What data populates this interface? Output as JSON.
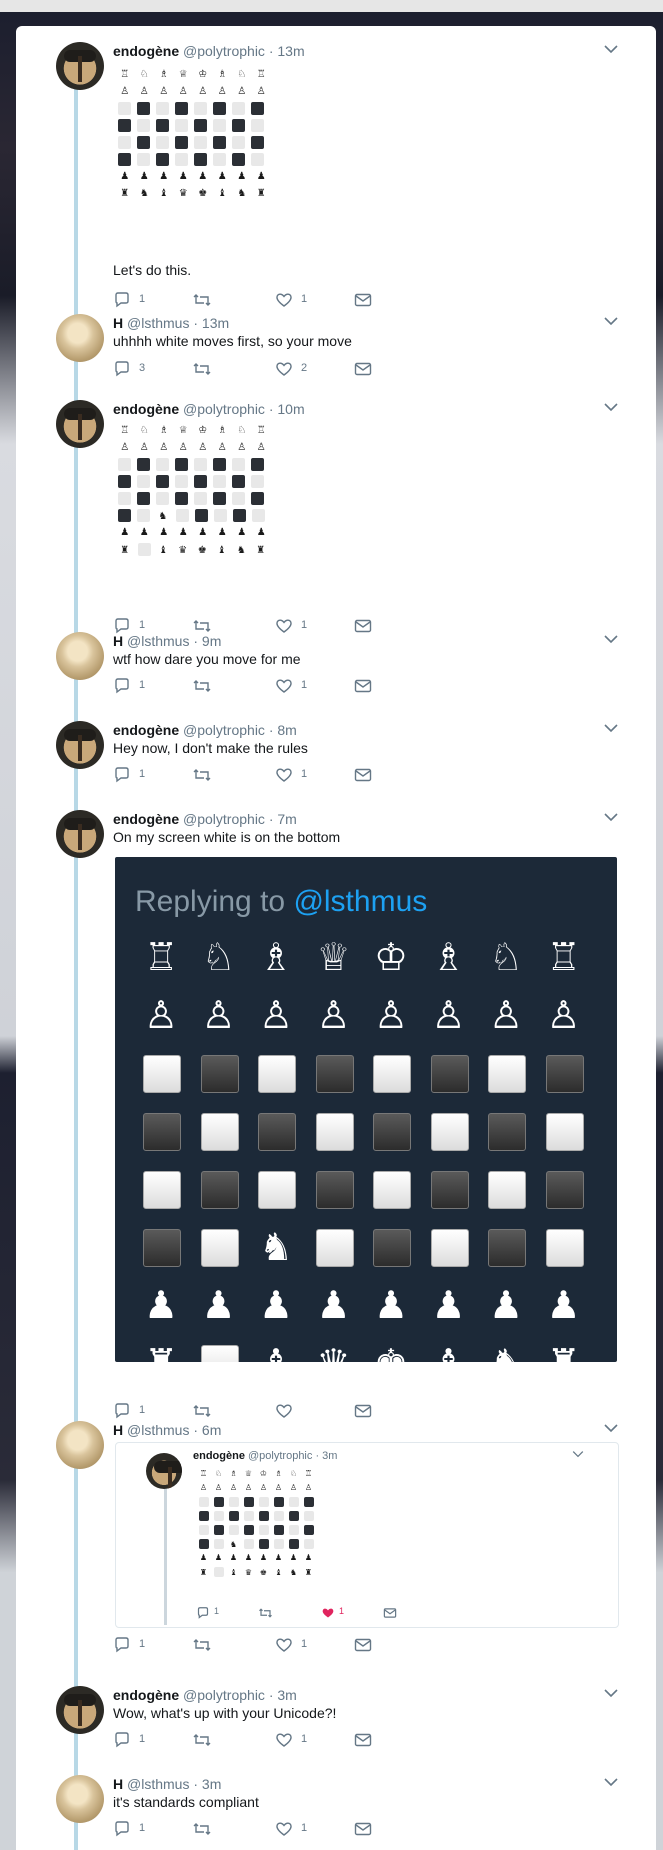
{
  "colors": {
    "accent": "#1da1f2",
    "text": "#14171a",
    "muted": "#657786",
    "thread": "#b8d8e6",
    "liked": "#e0245e"
  },
  "tweets": [
    {
      "name": "endogène",
      "handle": "@polytrophic",
      "time": "· 13m",
      "text": "Let's do this.",
      "replies": "1",
      "likes": "1",
      "avatar": "endo-avatar"
    },
    {
      "name": "H",
      "handle": "@lsthmus",
      "time": "· 13m",
      "text": "uhhhh white moves first, so your move",
      "replies": "3",
      "likes": "2",
      "avatar": "h-avatar"
    },
    {
      "name": "endogène",
      "handle": "@polytrophic",
      "time": "· 10m",
      "text": "",
      "replies": "1",
      "likes": "1",
      "avatar": "endo-avatar"
    },
    {
      "name": "H",
      "handle": "@lsthmus",
      "time": "· 9m",
      "text": "wtf how dare you move for me",
      "replies": "1",
      "likes": "1",
      "avatar": "h-avatar"
    },
    {
      "name": "endogène",
      "handle": "@polytrophic",
      "time": "· 8m",
      "text": "Hey now, I don't make the rules",
      "replies": "1",
      "likes": "1",
      "avatar": "endo-avatar"
    },
    {
      "name": "endogène",
      "handle": "@polytrophic",
      "time": "· 7m",
      "text": "On my screen white is on the bottom",
      "replies": "1",
      "likes": "",
      "avatar": "endo-avatar"
    },
    {
      "name": "H",
      "handle": "@lsthmus",
      "time": "· 6m",
      "text": "",
      "replies": "1",
      "likes": "1",
      "avatar": "h-avatar"
    },
    {
      "name": "endogène",
      "handle": "@polytrophic",
      "time": "· 3m",
      "text": "Wow, what's up with your Unicode?!",
      "replies": "1",
      "likes": "1",
      "avatar": "endo-avatar"
    },
    {
      "name": "H",
      "handle": "@lsthmus",
      "time": "· 3m",
      "text": "it's standards compliant",
      "replies": "1",
      "likes": "1",
      "avatar": "h-avatar"
    }
  ],
  "board1": {
    "rows": [
      [
        "♖",
        "♘",
        "♗",
        "♕",
        "♔",
        "♗",
        "♘",
        "♖"
      ],
      [
        "♙",
        "♙",
        "♙",
        "♙",
        "♙",
        "♙",
        "♙",
        "♙"
      ],
      [
        "l",
        "d",
        "l",
        "d",
        "l",
        "d",
        "l",
        "d"
      ],
      [
        "d",
        "l",
        "d",
        "l",
        "d",
        "l",
        "d",
        "l"
      ],
      [
        "l",
        "d",
        "l",
        "d",
        "l",
        "d",
        "l",
        "d"
      ],
      [
        "d",
        "l",
        "d",
        "l",
        "d",
        "l",
        "d",
        "l"
      ],
      [
        "♟",
        "♟",
        "♟",
        "♟",
        "♟",
        "♟",
        "♟",
        "♟"
      ],
      [
        "♜",
        "♞",
        "♝",
        "♛",
        "♚",
        "♝",
        "♞",
        "♜"
      ]
    ]
  },
  "board2": {
    "rows": [
      [
        "♖",
        "♘",
        "♗",
        "♕",
        "♔",
        "♗",
        "♘",
        "♖"
      ],
      [
        "♙",
        "♙",
        "♙",
        "♙",
        "♙",
        "♙",
        "♙",
        "♙"
      ],
      [
        "l",
        "d",
        "l",
        "d",
        "l",
        "d",
        "l",
        "d"
      ],
      [
        "d",
        "l",
        "d",
        "l",
        "d",
        "l",
        "d",
        "l"
      ],
      [
        "l",
        "d",
        "l",
        "d",
        "l",
        "d",
        "l",
        "d"
      ],
      [
        "d",
        "l",
        "♞",
        "l",
        "d",
        "l",
        "d",
        "l"
      ],
      [
        "♟",
        "♟",
        "♟",
        "♟",
        "♟",
        "♟",
        "♟",
        "♟"
      ],
      [
        "♜",
        "l",
        "♝",
        "♛",
        "♚",
        "♝",
        "♞",
        "♜"
      ]
    ]
  },
  "image": {
    "reply_prefix": "Replying to",
    "reply_handle": "@lsthmus",
    "rows": [
      [
        "♖",
        "♘",
        "♗",
        "♕",
        "♔",
        "♗",
        "♘",
        "♖"
      ],
      [
        "♙",
        "♙",
        "♙",
        "♙",
        "♙",
        "♙",
        "♙",
        "♙"
      ],
      [
        "l",
        "d",
        "l",
        "d",
        "l",
        "d",
        "l",
        "d"
      ],
      [
        "d",
        "l",
        "d",
        "l",
        "d",
        "l",
        "d",
        "l"
      ],
      [
        "l",
        "d",
        "l",
        "d",
        "l",
        "d",
        "l",
        "d"
      ],
      [
        "d",
        "l",
        "♞",
        "l",
        "d",
        "l",
        "d",
        "l"
      ],
      [
        "♟",
        "♟",
        "♟",
        "♟",
        "♟",
        "♟",
        "♟",
        "♟"
      ],
      [
        "♜",
        "l",
        "♝",
        "♛",
        "♚",
        "♝",
        "♞",
        "♜"
      ]
    ]
  },
  "quote": {
    "name": "endogène",
    "handle": "@polytrophic",
    "time": "· 3m",
    "replies": "1",
    "likes": "1"
  }
}
